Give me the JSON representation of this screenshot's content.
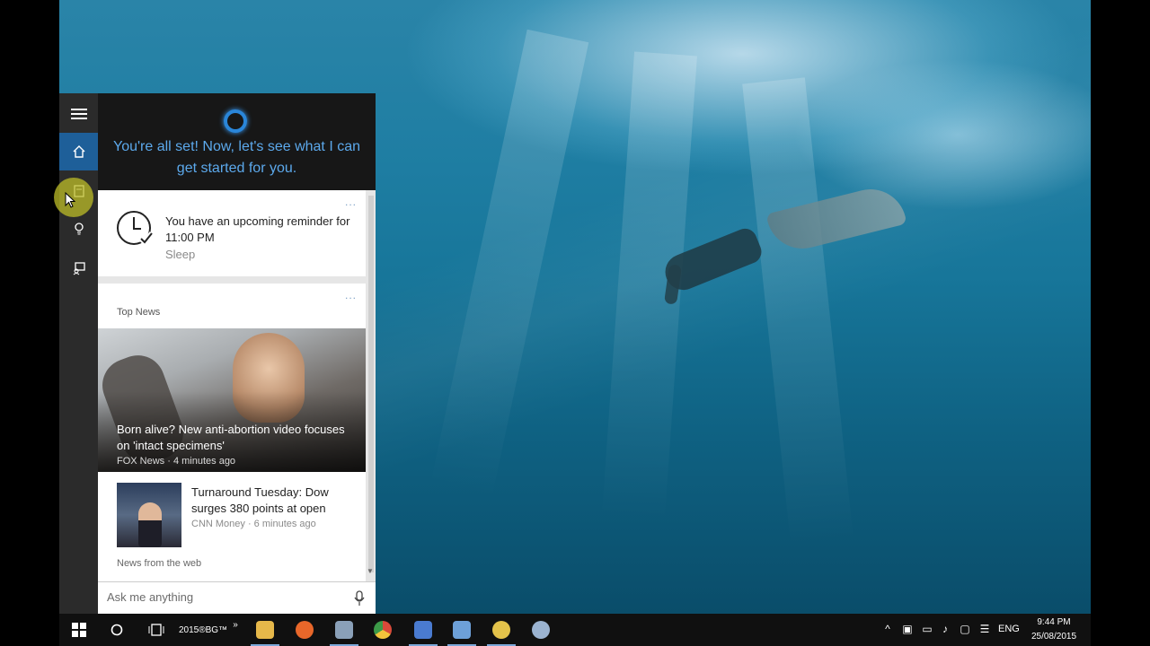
{
  "cortana": {
    "greeting": "You're all set! Now, let's see what I can get started for you.",
    "reminder_card": {
      "text": "You have an upcoming reminder for 11:00 PM",
      "subtitle": "Sleep",
      "more": "..."
    },
    "news_card": {
      "section_label": "Top News",
      "more": "...",
      "top_story": {
        "headline": "Born alive? New anti-abortion video focuses on 'intact specimens'",
        "source": "FOX News · 4 minutes ago"
      },
      "story2": {
        "headline": "Turnaround Tuesday: Dow surges 380 points at open",
        "source": "CNN Money · 6 minutes ago"
      },
      "footer": "News from the web"
    },
    "search": {
      "placeholder": "Ask me anything"
    }
  },
  "rail": {
    "items": [
      {
        "icon": "hamburger-icon"
      },
      {
        "icon": "home-icon"
      },
      {
        "icon": "notebook-icon"
      },
      {
        "icon": "reminders-icon"
      },
      {
        "icon": "feedback-icon"
      }
    ]
  },
  "taskbar": {
    "toolbar_label": "2015®BG™",
    "overflow": "»",
    "apps": [
      {
        "name": "file-explorer",
        "color": "#e6b84a"
      },
      {
        "name": "firefox",
        "color": "#e8672a"
      },
      {
        "name": "paint",
        "color": "#8aa0b8"
      },
      {
        "name": "chrome",
        "color": "#3c9a48"
      },
      {
        "name": "remote-desktop",
        "color": "#4a7bd0"
      },
      {
        "name": "network-tool",
        "color": "#6da0d8"
      },
      {
        "name": "messenger",
        "color": "#e3c24a"
      },
      {
        "name": "browser",
        "color": "#9bb3d0"
      }
    ],
    "language": "ENG",
    "time": "9:44 PM",
    "date": "25/08/2015"
  },
  "colors": {
    "accent": "#1e5f99",
    "cortana_blue": "#5ca9ec",
    "taskbar": "#101010"
  }
}
